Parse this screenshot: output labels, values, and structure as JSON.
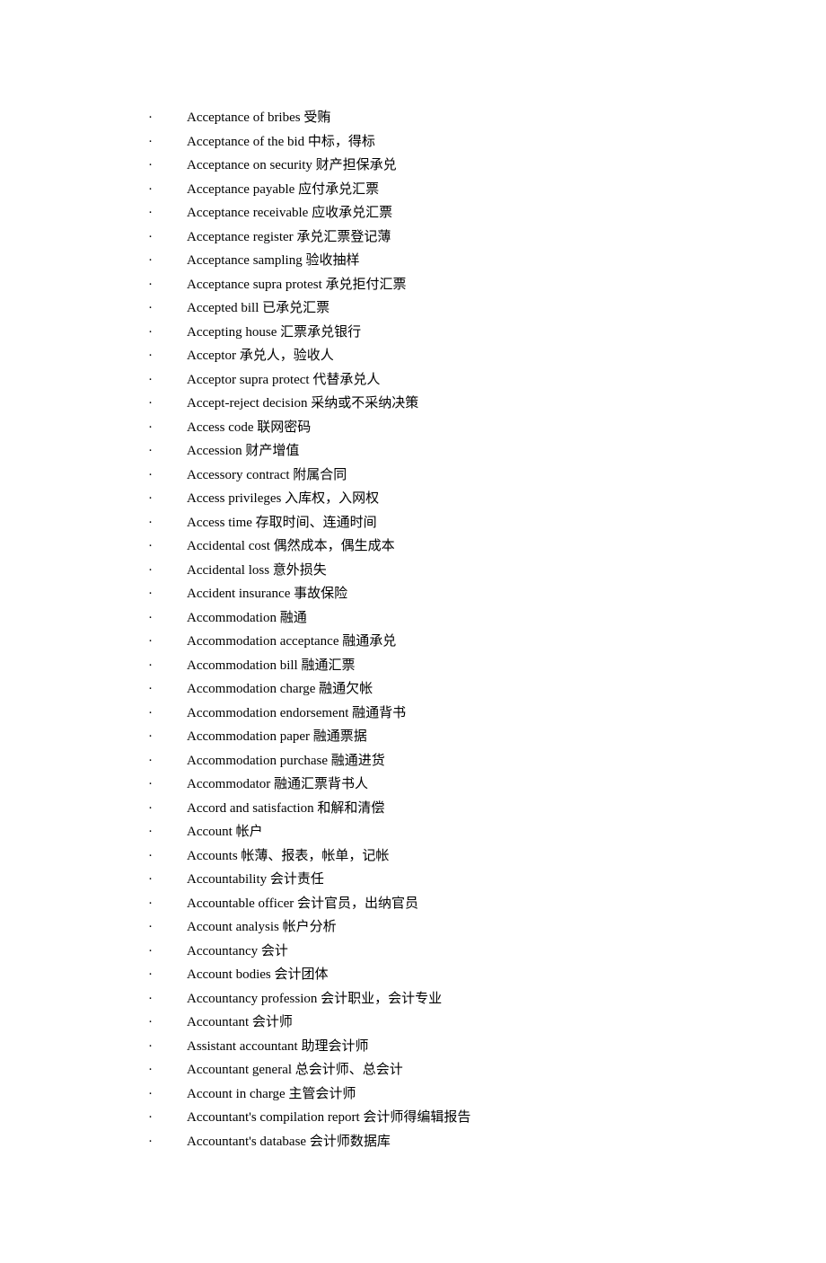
{
  "entries": [
    "Acceptance of bribes  受贿",
    "Acceptance of the bid  中标，得标",
    "Acceptance on security  财产担保承兑",
    "Acceptance payable  应付承兑汇票",
    "Acceptance receivable  应收承兑汇票",
    "Acceptance register  承兑汇票登记薄",
    "Acceptance sampling  验收抽样",
    "Acceptance supra protest  承兑拒付汇票",
    "Accepted bill  已承兑汇票",
    "Accepting house  汇票承兑银行",
    "Acceptor  承兑人，验收人",
    "Acceptor supra protect  代替承兑人",
    "Accept-reject decision  采纳或不采纳决策",
    "Access code  联网密码",
    "Accession  财产增值",
    "Accessory contract  附属合同",
    "Access privileges  入库权，入网权",
    "Access time  存取时间、连通时间",
    "Accidental cost  偶然成本，偶生成本",
    "Accidental loss  意外损失",
    "Accident insurance  事故保险",
    "Accommodation  融通",
    "Accommodation acceptance  融通承兑",
    "Accommodation bill  融通汇票",
    "Accommodation charge  融通欠帐",
    "Accommodation endorsement  融通背书",
    "Accommodation paper  融通票据",
    "Accommodation purchase  融通进货",
    "Accommodator  融通汇票背书人",
    "Accord and satisfaction  和解和清偿",
    "Account  帐户",
    "Accounts 帐薄、报表，帐单，记帐",
    "Accountability  会计责任",
    "Accountable officer  会计官员，出纳官员",
    "Account analysis 帐户分析",
    "Accountancy  会计",
    "Account bodies  会计团体",
    "Accountancy profession  会计职业，会计专业",
    "Accountant  会计师",
    "Assistant accountant  助理会计师",
    "Accountant general  总会计师、总会计",
    "Account in charge  主管会计师",
    "Accountant's compilation report  会计师得编辑报告",
    "Accountant's database  会计师数据库"
  ]
}
